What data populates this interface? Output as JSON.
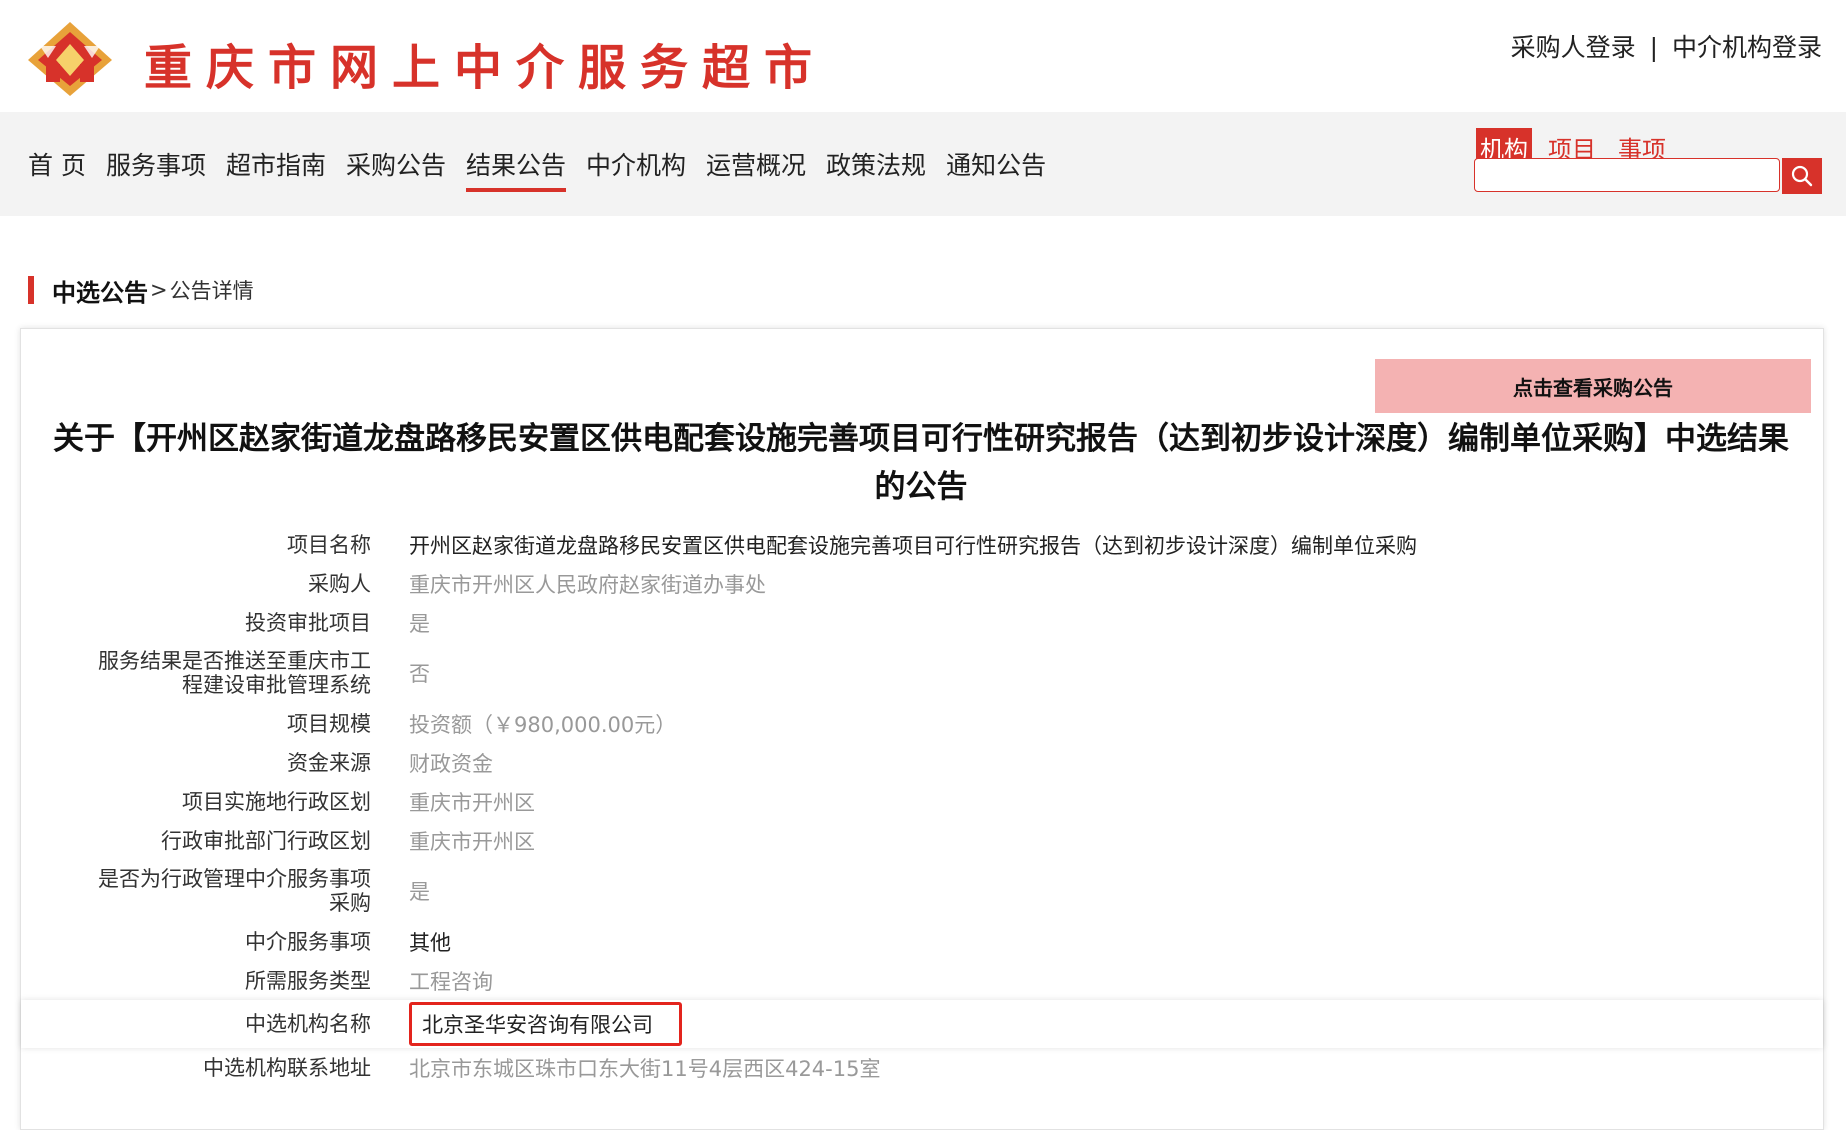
{
  "header": {
    "site_title": "重庆市网上中介服务超市",
    "login_buyer": "采购人登录",
    "login_sep": "|",
    "login_agency": "中介机构登录"
  },
  "nav": {
    "items": [
      "首 页",
      "服务事项",
      "超市指南",
      "采购公告",
      "结果公告",
      "中介机构",
      "运营概况",
      "政策法规",
      "通知公告"
    ],
    "active_index": 4
  },
  "search": {
    "tabs": [
      "机构",
      "项目",
      "事项"
    ],
    "active_tab": 0,
    "value": "",
    "placeholder": ""
  },
  "breadcrumb": {
    "main": "中选公告",
    "sep": ">",
    "sub": "公告详情"
  },
  "notice": {
    "view_button": "点击查看采购公告",
    "title": "关于【开州区赵家街道龙盘路移民安置区供电配套设施完善项目可行性研究报告（达到初步设计深度）编制单位采购】中选结果的公告",
    "fields": [
      {
        "label": "项目名称",
        "value": "开州区赵家街道龙盘路移民安置区供电配套设施完善项目可行性研究报告（达到初步设计深度）编制单位采购"
      },
      {
        "label": "采购人",
        "value": "重庆市开州区人民政府赵家街道办事处"
      },
      {
        "label": "投资审批项目",
        "value": "是"
      },
      {
        "label": "服务结果是否推送至重庆市工程建设审批管理系统",
        "value": "否"
      },
      {
        "label": "项目规模",
        "value": "投资额（￥980,000.00元）"
      },
      {
        "label": "资金来源",
        "value": "财政资金"
      },
      {
        "label": "项目实施地行政区划",
        "value": "重庆市开州区"
      },
      {
        "label": "行政审批部门行政区划",
        "value": "重庆市开州区"
      },
      {
        "label": "是否为行政管理中介服务事项采购",
        "value": "是"
      },
      {
        "label": "中介服务事项",
        "value": "其他"
      },
      {
        "label": "所需服务类型",
        "value": "工程咨询"
      },
      {
        "label": "中选机构名称",
        "value": "北京圣华安咨询有限公司"
      },
      {
        "label": "中选机构联系地址",
        "value": "北京市东城区珠市口东大街11号4层西区424-15室"
      }
    ]
  },
  "colors": {
    "brand_red": "#d7322a",
    "button_pink": "#f4b2b2",
    "highlight_red": "#e3241d"
  },
  "icons": {
    "logo": "site-logo",
    "search": "search-icon"
  }
}
